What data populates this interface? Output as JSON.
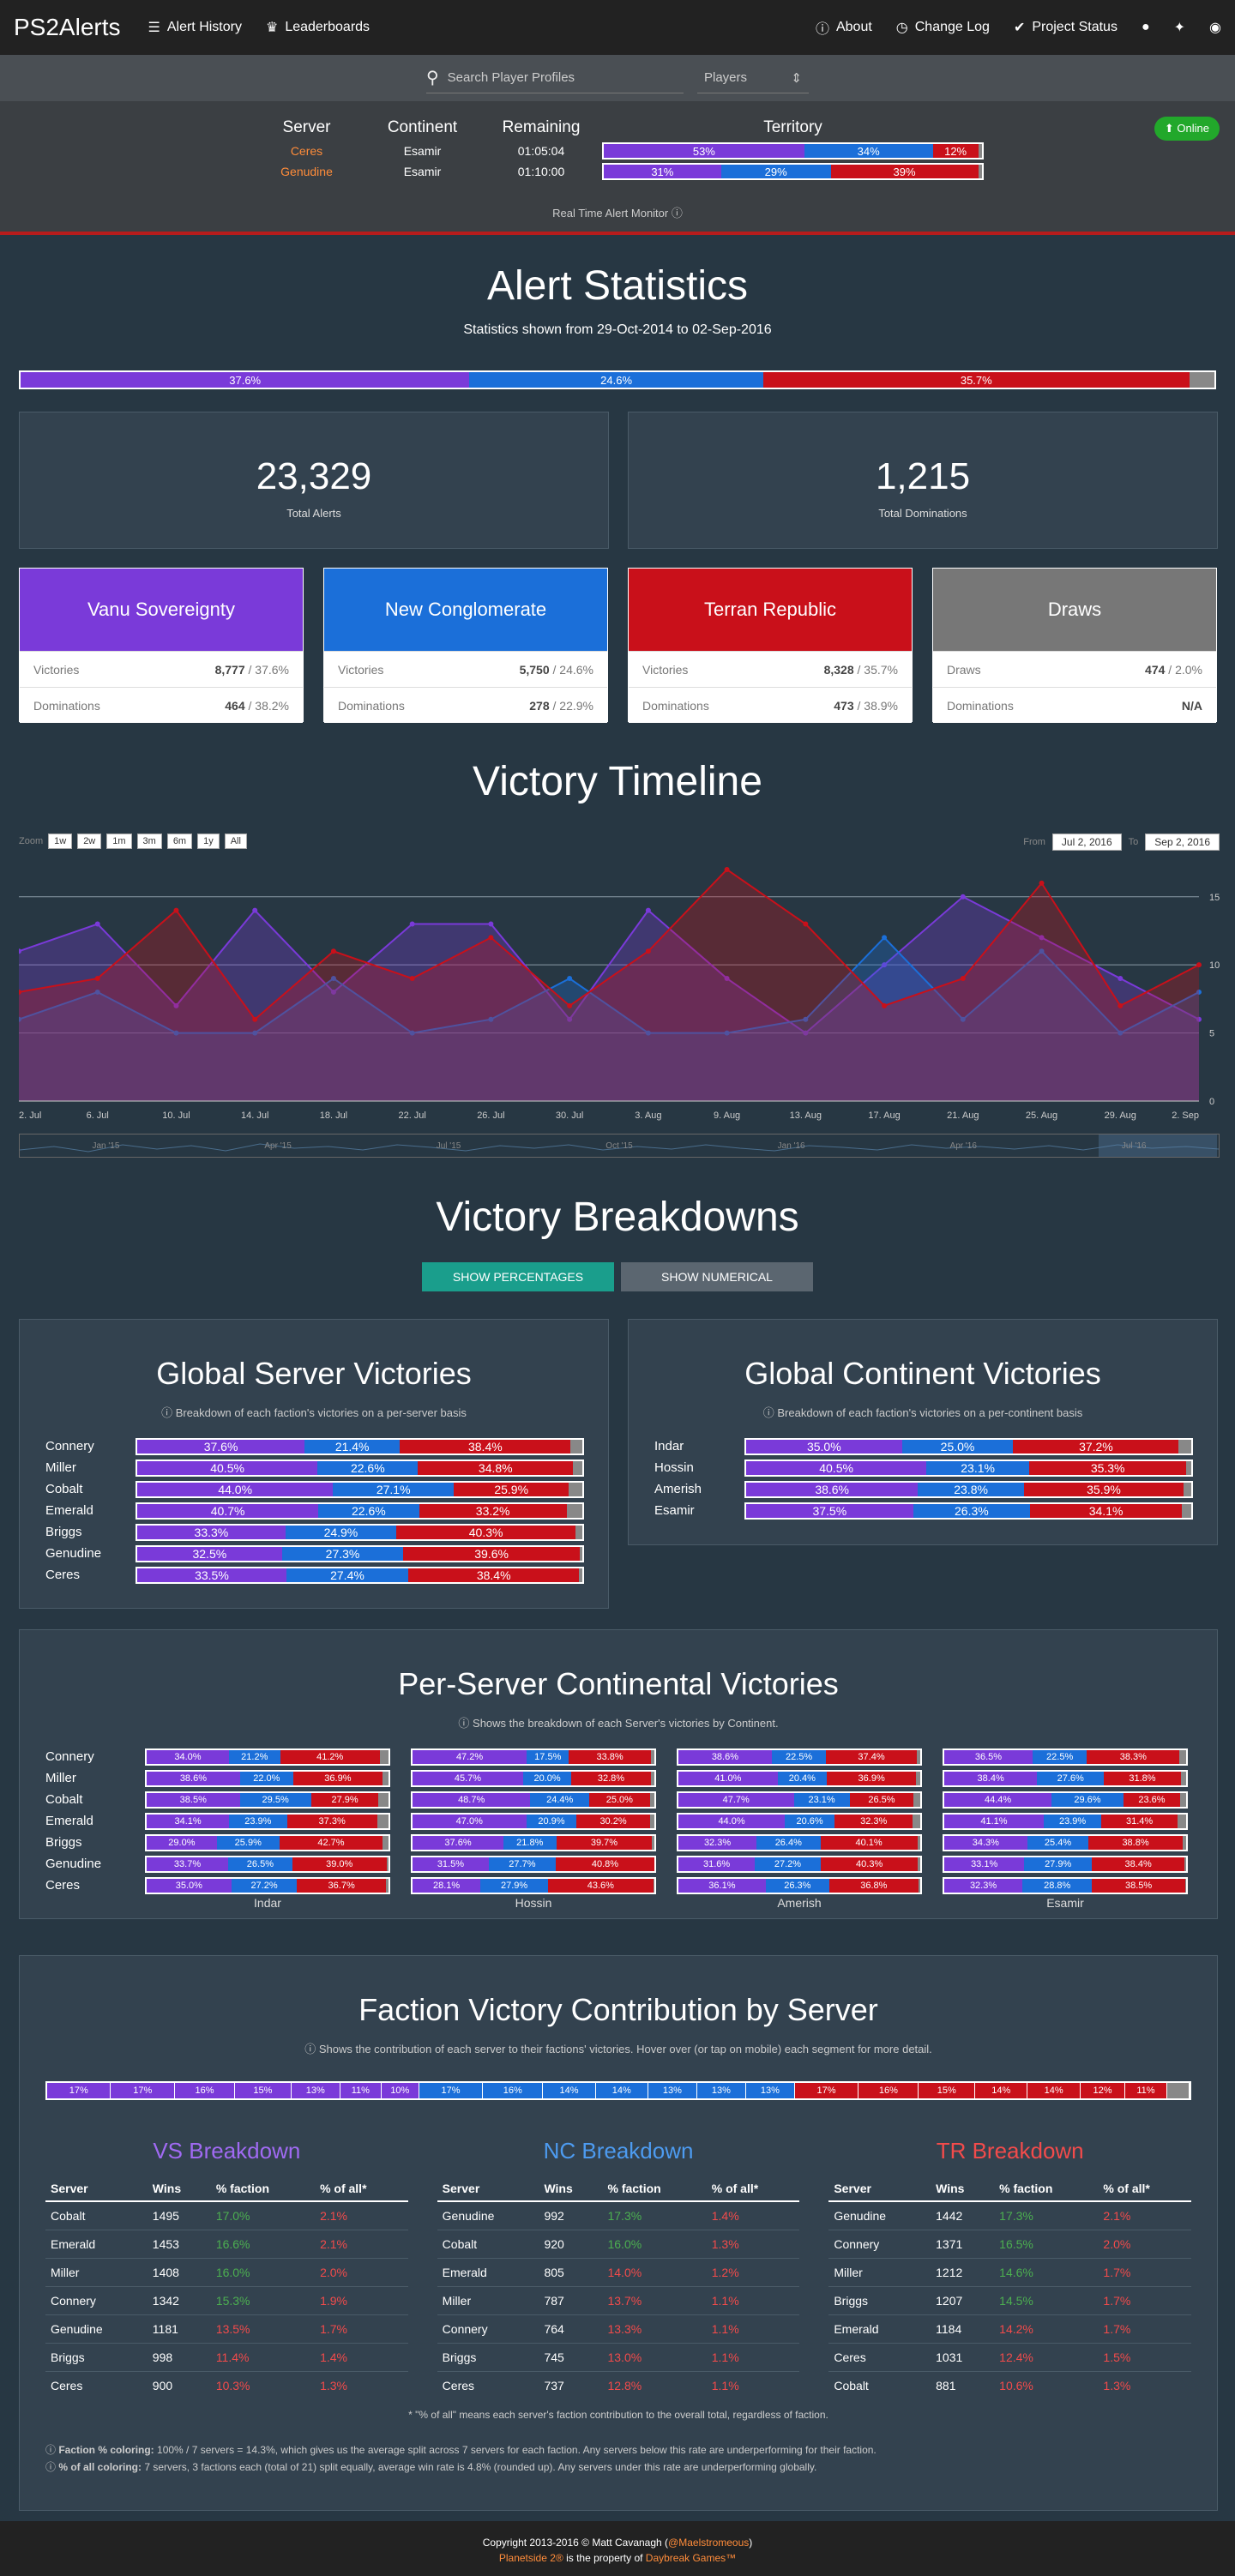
{
  "nav": {
    "brand": "PS2Alerts",
    "items": [
      "Alert History",
      "Leaderboards"
    ],
    "right": [
      "About",
      "Change Log",
      "Project Status"
    ]
  },
  "search": {
    "placeholder": "Search Player Profiles",
    "select": "Players"
  },
  "monitor": {
    "headers": [
      "Server",
      "Continent",
      "Remaining",
      "Territory"
    ],
    "rows": [
      {
        "server": "Ceres",
        "continent": "Esamir",
        "remaining": "01:05:04",
        "vs": "53%",
        "nc": "34%",
        "tr": "12%",
        "vsv": 53,
        "ncv": 34,
        "trv": 12
      },
      {
        "server": "Genudine",
        "continent": "Esamir",
        "remaining": "01:10:00",
        "vs": "31%",
        "nc": "29%",
        "tr": "39%",
        "vsv": 31,
        "ncv": 29,
        "trv": 39
      }
    ],
    "status": "Online",
    "caption": "Real Time Alert Monitor"
  },
  "stats": {
    "title": "Alert Statistics",
    "subtitle": "Statistics shown from 29-Oct-2014 to 02-Sep-2016",
    "bar": {
      "vs": "37.6%",
      "nc": "24.6%",
      "tr": "35.7%",
      "vsv": 37.6,
      "ncv": 24.6,
      "trv": 35.7,
      "drv": 2.1
    },
    "total_alerts": "23,329",
    "total_alerts_label": "Total Alerts",
    "total_dominations": "1,215",
    "total_dominations_label": "Total Dominations",
    "factions": [
      {
        "name": "Vanu Sovereignty",
        "r1l": "Victories",
        "r1n": "8,777",
        "r1p": " / 37.6%",
        "r2l": "Dominations",
        "r2n": "464",
        "r2p": " / 38.2%",
        "color": "#7a3ad9"
      },
      {
        "name": "New Conglomerate",
        "r1l": "Victories",
        "r1n": "5,750",
        "r1p": " / 24.6%",
        "r2l": "Dominations",
        "r2n": "278",
        "r2p": " / 22.9%",
        "color": "#1b6fd9"
      },
      {
        "name": "Terran Republic",
        "r1l": "Victories",
        "r1n": "8,328",
        "r1p": " / 35.7%",
        "r2l": "Dominations",
        "r2n": "473",
        "r2p": " / 38.9%",
        "color": "#c9101a"
      },
      {
        "name": "Draws",
        "r1l": "Draws",
        "r1n": "474",
        "r1p": " / 2.0%",
        "r2l": "Dominations",
        "r2n": "N/A",
        "r2p": "",
        "color": "#777777"
      }
    ]
  },
  "timeline": {
    "title": "Victory Timeline",
    "zoom_label": "Zoom",
    "zoom": [
      "1w",
      "2w",
      "1m",
      "3m",
      "6m",
      "1y",
      "All"
    ],
    "from_label": "From",
    "from": "Jul 2, 2016",
    "to_label": "To",
    "to": "Sep 2, 2016",
    "nav_labels": [
      "Jan '15",
      "Apr '15",
      "Jul '15",
      "Oct '15",
      "Jan '16",
      "Apr '16",
      "Jul '16"
    ]
  },
  "chart_data": {
    "type": "area",
    "x": [
      "2. Jul",
      "6. Jul",
      "10. Jul",
      "14. Jul",
      "18. Jul",
      "22. Jul",
      "26. Jul",
      "30. Jul",
      "3. Aug",
      "9. Aug",
      "13. Aug",
      "17. Aug",
      "21. Aug",
      "25. Aug",
      "29. Aug",
      "2. Sep"
    ],
    "ylim": [
      0,
      17
    ],
    "yticks": [
      "0",
      "5",
      "10",
      "15"
    ],
    "series": [
      {
        "color": "#7a3ad9",
        "values": [
          11,
          13,
          7,
          14,
          8,
          13,
          13,
          6,
          14,
          9,
          5,
          10,
          15,
          12,
          9,
          6
        ]
      },
      {
        "color": "#1b6fd9",
        "values": [
          6,
          8,
          5,
          5,
          9,
          5,
          6,
          9,
          5,
          5,
          6,
          12,
          6,
          11,
          5,
          8
        ]
      },
      {
        "color": "#c9101a",
        "values": [
          8,
          9,
          14,
          6,
          11,
          9,
          12,
          7,
          11,
          17,
          13,
          7,
          9,
          16,
          7,
          10
        ]
      }
    ]
  },
  "breakdowns": {
    "title": "Victory Breakdowns",
    "btn_pct": "SHOW PERCENTAGES",
    "btn_num": "SHOW NUMERICAL",
    "server": {
      "title": "Global Server Victories",
      "note": "Breakdown of each faction's victories on a per-server basis",
      "rows": [
        {
          "n": "Connery",
          "vs": "37.6%",
          "nc": "21.4%",
          "tr": "38.4%",
          "a": 37.6,
          "b": 21.4,
          "c": 38.4
        },
        {
          "n": "Miller",
          "vs": "40.5%",
          "nc": "22.6%",
          "tr": "34.8%",
          "a": 40.5,
          "b": 22.6,
          "c": 34.8
        },
        {
          "n": "Cobalt",
          "vs": "44.0%",
          "nc": "27.1%",
          "tr": "25.9%",
          "a": 44.0,
          "b": 27.1,
          "c": 25.9
        },
        {
          "n": "Emerald",
          "vs": "40.7%",
          "nc": "22.6%",
          "tr": "33.2%",
          "a": 40.7,
          "b": 22.6,
          "c": 33.2
        },
        {
          "n": "Briggs",
          "vs": "33.3%",
          "nc": "24.9%",
          "tr": "40.3%",
          "a": 33.3,
          "b": 24.9,
          "c": 40.3
        },
        {
          "n": "Genudine",
          "vs": "32.5%",
          "nc": "27.3%",
          "tr": "39.6%",
          "a": 32.5,
          "b": 27.3,
          "c": 39.6
        },
        {
          "n": "Ceres",
          "vs": "33.5%",
          "nc": "27.4%",
          "tr": "38.4%",
          "a": 33.5,
          "b": 27.4,
          "c": 38.4
        }
      ]
    },
    "continent": {
      "title": "Global Continent Victories",
      "note": "Breakdown of each faction's victories on a per-continent basis",
      "rows": [
        {
          "n": "Indar",
          "vs": "35.0%",
          "nc": "25.0%",
          "tr": "37.2%",
          "a": 35.0,
          "b": 25.0,
          "c": 37.2
        },
        {
          "n": "Hossin",
          "vs": "40.5%",
          "nc": "23.1%",
          "tr": "35.3%",
          "a": 40.5,
          "b": 23.1,
          "c": 35.3
        },
        {
          "n": "Amerish",
          "vs": "38.6%",
          "nc": "23.8%",
          "tr": "35.9%",
          "a": 38.6,
          "b": 23.8,
          "c": 35.9
        },
        {
          "n": "Esamir",
          "vs": "37.5%",
          "nc": "26.3%",
          "tr": "34.1%",
          "a": 37.5,
          "b": 26.3,
          "c": 34.1
        }
      ]
    },
    "per_server": {
      "title": "Per-Server Continental Victories",
      "note": "Shows the breakdown of each Server's victories by Continent.",
      "continents": [
        "Indar",
        "Hossin",
        "Amerish",
        "Esamir"
      ],
      "rows": [
        {
          "n": "Connery",
          "c": [
            [
              "34.0%",
              "21.2%",
              "41.2%"
            ],
            [
              "47.2%",
              "17.5%",
              "33.8%"
            ],
            [
              "38.6%",
              "22.5%",
              "37.4%"
            ],
            [
              "36.5%",
              "22.5%",
              "38.3%"
            ]
          ]
        },
        {
          "n": "Miller",
          "c": [
            [
              "38.6%",
              "22.0%",
              "36.9%"
            ],
            [
              "45.7%",
              "20.0%",
              "32.8%"
            ],
            [
              "41.0%",
              "20.4%",
              "36.9%"
            ],
            [
              "38.4%",
              "27.6%",
              "31.8%"
            ]
          ]
        },
        {
          "n": "Cobalt",
          "c": [
            [
              "38.5%",
              "29.5%",
              "27.9%"
            ],
            [
              "48.7%",
              "24.4%",
              "25.0%"
            ],
            [
              "47.7%",
              "23.1%",
              "26.5%"
            ],
            [
              "44.4%",
              "29.6%",
              "23.6%"
            ]
          ]
        },
        {
          "n": "Emerald",
          "c": [
            [
              "34.1%",
              "23.9%",
              "37.3%"
            ],
            [
              "47.0%",
              "20.9%",
              "30.2%"
            ],
            [
              "44.0%",
              "20.6%",
              "32.3%"
            ],
            [
              "41.1%",
              "23.9%",
              "31.4%"
            ]
          ]
        },
        {
          "n": "Briggs",
          "c": [
            [
              "29.0%",
              "25.9%",
              "42.7%"
            ],
            [
              "37.6%",
              "21.8%",
              "39.7%"
            ],
            [
              "32.3%",
              "26.4%",
              "40.1%"
            ],
            [
              "34.3%",
              "25.4%",
              "38.8%"
            ]
          ]
        },
        {
          "n": "Genudine",
          "c": [
            [
              "33.7%",
              "26.5%",
              "39.0%"
            ],
            [
              "31.5%",
              "27.7%",
              "40.8%"
            ],
            [
              "31.6%",
              "27.2%",
              "40.3%"
            ],
            [
              "33.1%",
              "27.9%",
              "38.4%"
            ]
          ]
        },
        {
          "n": "Ceres",
          "c": [
            [
              "35.0%",
              "27.2%",
              "36.7%"
            ],
            [
              "28.1%",
              "27.9%",
              "43.6%"
            ],
            [
              "36.1%",
              "26.3%",
              "36.8%"
            ],
            [
              "32.3%",
              "28.8%",
              "38.5%"
            ]
          ]
        }
      ]
    }
  },
  "contribution": {
    "title": "Faction Victory Contribution by Server",
    "note": "Shows the contribution of each server to their factions' victories. Hover over (or tap on mobile) each segment for more detail.",
    "vs": [
      "17%",
      "17%",
      "16%",
      "15%",
      "13%",
      "11%",
      "10%"
    ],
    "nc": [
      "17%",
      "16%",
      "14%",
      "14%",
      "13%",
      "13%",
      "13%"
    ],
    "tr": [
      "17%",
      "16%",
      "15%",
      "14%",
      "14%",
      "12%",
      "11%"
    ],
    "headers": [
      "Server",
      "Wins",
      "% faction",
      "% of all*"
    ],
    "tables": [
      {
        "title": "VS Breakdown",
        "color": "#a06af2",
        "rows": [
          [
            "Cobalt",
            "1495",
            "17.0%",
            "2.1%",
            "g"
          ],
          [
            "Emerald",
            "1453",
            "16.6%",
            "2.1%",
            "g"
          ],
          [
            "Miller",
            "1408",
            "16.0%",
            "2.0%",
            "g"
          ],
          [
            "Connery",
            "1342",
            "15.3%",
            "1.9%",
            "g"
          ],
          [
            "Genudine",
            "1181",
            "13.5%",
            "1.7%",
            "r"
          ],
          [
            "Briggs",
            "998",
            "11.4%",
            "1.4%",
            "r"
          ],
          [
            "Ceres",
            "900",
            "10.3%",
            "1.3%",
            "r"
          ]
        ]
      },
      {
        "title": "NC Breakdown",
        "color": "#4d9bf0",
        "rows": [
          [
            "Genudine",
            "992",
            "17.3%",
            "1.4%",
            "g"
          ],
          [
            "Cobalt",
            "920",
            "16.0%",
            "1.3%",
            "g"
          ],
          [
            "Emerald",
            "805",
            "14.0%",
            "1.2%",
            "r"
          ],
          [
            "Miller",
            "787",
            "13.7%",
            "1.1%",
            "r"
          ],
          [
            "Connery",
            "764",
            "13.3%",
            "1.1%",
            "r"
          ],
          [
            "Briggs",
            "745",
            "13.0%",
            "1.1%",
            "r"
          ],
          [
            "Ceres",
            "737",
            "12.8%",
            "1.1%",
            "r"
          ]
        ]
      },
      {
        "title": "TR Breakdown",
        "color": "#f24b4b",
        "rows": [
          [
            "Genudine",
            "1442",
            "17.3%",
            "2.1%",
            "g"
          ],
          [
            "Connery",
            "1371",
            "16.5%",
            "2.0%",
            "g"
          ],
          [
            "Miller",
            "1212",
            "14.6%",
            "1.7%",
            "g"
          ],
          [
            "Briggs",
            "1207",
            "14.5%",
            "1.7%",
            "g"
          ],
          [
            "Emerald",
            "1184",
            "14.2%",
            "1.7%",
            "r"
          ],
          [
            "Ceres",
            "1031",
            "12.4%",
            "1.5%",
            "r"
          ],
          [
            "Cobalt",
            "881",
            "10.6%",
            "1.3%",
            "r"
          ]
        ]
      }
    ],
    "footnote": "* \"% of all\" means each server's faction contribution to the overall total, regardless of faction.",
    "legend1_b": "Faction % coloring:",
    "legend1": " 100% / 7 servers = 14.3%, which gives us the average split across 7 servers for each faction. Any servers below this rate are underperforming for their faction.",
    "legend2_b": "% of all coloring:",
    "legend2": " 7 servers, 3 factions each (total of 21) split equally, average win rate is 4.8% (rounded up). Any servers under this rate are underperforming globally."
  },
  "footer": {
    "line1": "Copyright 2013-2016 © Matt Cavanagh (",
    "handle": "@Maelstromeous",
    "line1end": ")",
    "game": "Planetside 2®",
    "mid": " is the property of ",
    "company": "Daybreak Games™"
  }
}
